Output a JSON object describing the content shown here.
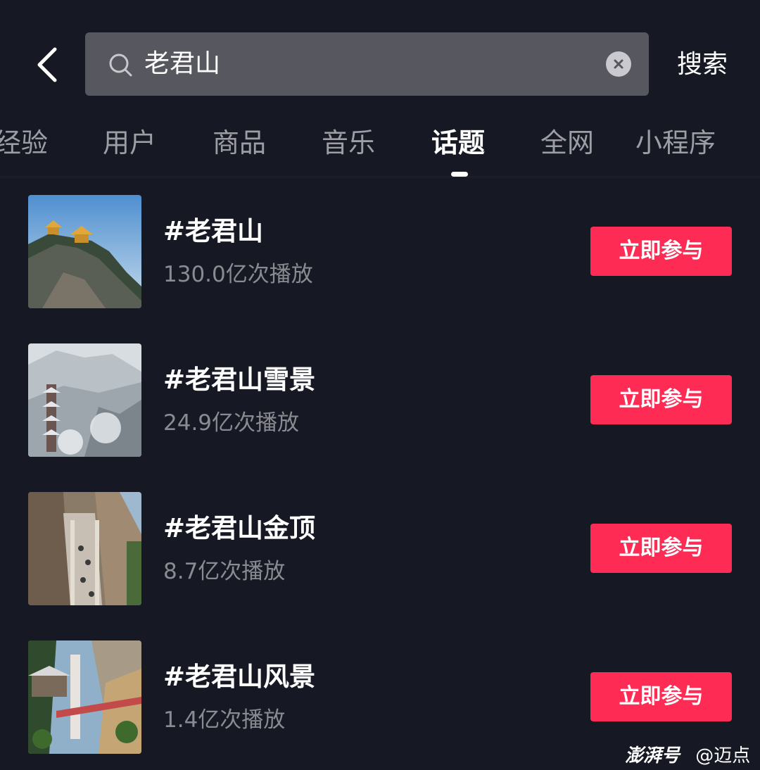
{
  "search": {
    "query": "老君山",
    "submit_label": "搜索"
  },
  "tabs": [
    {
      "label": "经验"
    },
    {
      "label": "用户"
    },
    {
      "label": "商品"
    },
    {
      "label": "音乐"
    },
    {
      "label": "话题",
      "active": true
    },
    {
      "label": "全网"
    },
    {
      "label": "小程序"
    }
  ],
  "topics": [
    {
      "title": "#老君山",
      "plays": "130.0亿次播放",
      "action": "立即参与"
    },
    {
      "title": "#老君山雪景",
      "plays": "24.9亿次播放",
      "action": "立即参与"
    },
    {
      "title": "#老君山金顶",
      "plays": "8.7亿次播放",
      "action": "立即参与"
    },
    {
      "title": "#老君山风景",
      "plays": "1.4亿次播放",
      "action": "立即参与"
    }
  ],
  "watermark": {
    "logo": "澎湃号",
    "author": "@迈点"
  },
  "colors": {
    "background": "#161823",
    "accent": "#fe2c55",
    "search_bg": "#57575f"
  },
  "icons": {
    "back": "back-chevron-icon",
    "search": "search-icon",
    "clear": "clear-icon"
  }
}
